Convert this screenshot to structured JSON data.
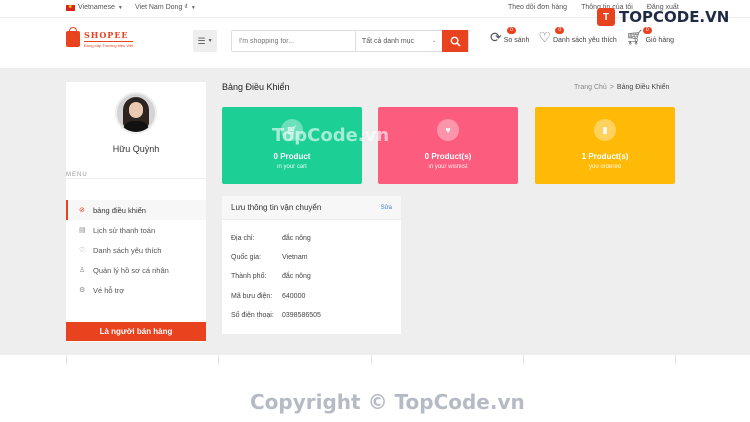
{
  "topbar": {
    "language": "Vietnamese",
    "currency": "Viet Nam Dong ₫",
    "links": [
      "Theo dõi đơn hàng",
      "Thông tin của tôi",
      "Đăng xuất"
    ]
  },
  "brand": {
    "name": "SHOPEE",
    "slogan": "Đồng cấp Thương hiệu Việt",
    "accent": "#e8421f"
  },
  "search": {
    "placeholder": "I'm shopping for...",
    "category": "Tất cả danh mục"
  },
  "header_icons": [
    {
      "icon": "compare-icon",
      "label": "So sánh",
      "count": "0"
    },
    {
      "icon": "heart-icon",
      "label": "Danh sách yêu thích",
      "count": "0"
    },
    {
      "icon": "cart-icon",
      "label": "Giỏ hàng",
      "count": "0"
    }
  ],
  "watermark": {
    "top": "TOPCODE.VN",
    "mid": "TopCode.vn",
    "bottom": "Copyright © TopCode.vn"
  },
  "profile": {
    "name": "Hữu Quỳnh",
    "menu_label": "MENU"
  },
  "sidenav": [
    {
      "icon": "dashboard-icon",
      "label": "bảng điều khiển",
      "active": true
    },
    {
      "icon": "file-icon",
      "label": "Lịch sử thanh toán"
    },
    {
      "icon": "heart-icon",
      "label": "Danh sách yêu thích"
    },
    {
      "icon": "user-icon",
      "label": "Quản lý hồ sơ cá nhân"
    },
    {
      "icon": "support-icon",
      "label": "Vé hỗ trợ"
    }
  ],
  "sell_button": "Là người bán hàng",
  "page": {
    "title": "Bảng Điều Khiển",
    "breadcrumb": [
      "Trang Chủ",
      "Bảng Điều Khiển"
    ]
  },
  "cards": [
    {
      "value": "0 Product",
      "label": "in your cart",
      "color": "#1ccf95",
      "icon": "cart-icon"
    },
    {
      "value": "0 Product(s)",
      "label": "in your wishlist",
      "color": "#fc5c7d",
      "icon": "heart-icon"
    },
    {
      "value": "1 Product(s)",
      "label": "you ordered",
      "color": "#ffba08",
      "icon": "box-icon"
    }
  ],
  "shipping": {
    "title": "Lưu thông tin vận chuyển",
    "edit": "Sửa",
    "rows": [
      {
        "key": "Địa chỉ:",
        "value": "đắc nông"
      },
      {
        "key": "Quốc gia:",
        "value": "Vietnam"
      },
      {
        "key": "Thành phố:",
        "value": "đắc nông"
      },
      {
        "key": "Mã bưu điện:",
        "value": "640000"
      },
      {
        "key": "Số điện thoại:",
        "value": "0398586505"
      }
    ]
  }
}
